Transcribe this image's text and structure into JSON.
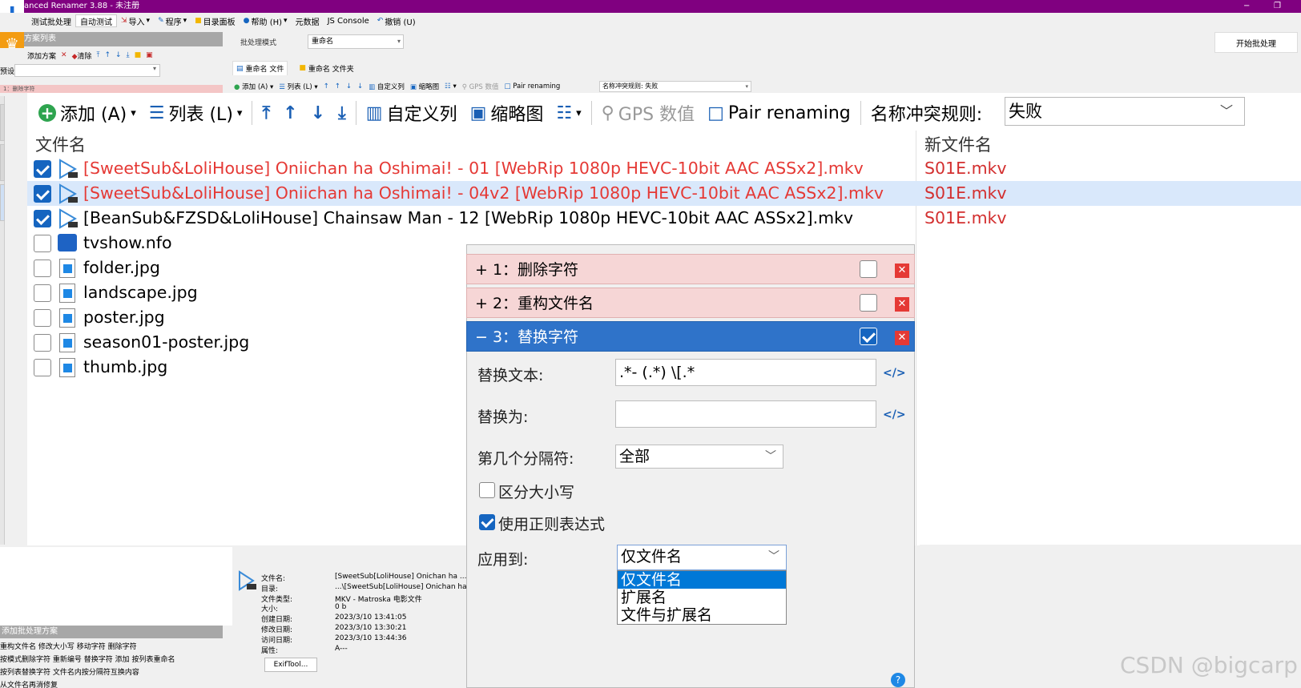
{
  "window": {
    "title": "anced Renamer 3.88 - 未注册",
    "minimize": "−",
    "maximize": "❐"
  },
  "menu": [
    {
      "label": "测试批处理"
    },
    {
      "label": "自动测试"
    },
    {
      "label": "导入",
      "icon": "import-icon"
    },
    {
      "label": "程序",
      "icon": "program-icon"
    },
    {
      "label": "目录面板",
      "icon": "folder-icon"
    },
    {
      "label": "帮助 (H)",
      "icon": "help-icon"
    },
    {
      "label": "元数据"
    },
    {
      "label": "JS Console"
    },
    {
      "label": "撤销 (U)",
      "icon": "undo-icon"
    }
  ],
  "left_panel": {
    "header": "方案列表",
    "toolbar": [
      "添加方案",
      "清除"
    ],
    "combo_label": "预设:",
    "rule_strip": "1：删除字符"
  },
  "top": {
    "mode_label": "批处理模式",
    "mode_value": "重命名",
    "start_button": "开始批处理"
  },
  "tabs": [
    {
      "label": "重命名 文件",
      "active": true
    },
    {
      "label": "重命名 文件夹",
      "active": false
    }
  ],
  "small_toolbar": {
    "items": [
      "添加 (A)",
      "列表 (L)",
      "↑",
      "↑",
      "↓",
      "↓",
      "自定义列",
      "缩略图",
      "GPS 数值",
      "Pair renaming"
    ],
    "conflict": "名称冲突规则: 失败"
  },
  "toolbar": {
    "add": "添加 (A)",
    "list": "列表 (L)",
    "move_top": "⤒",
    "move_up": "↑",
    "move_down": "↓",
    "move_bottom": "⤓",
    "custom_columns": "自定义列",
    "thumbnail": "缩略图",
    "gps": "GPS 数值",
    "pair": "Pair renaming",
    "conflict_label": "名称冲突规则:",
    "conflict_value": "失败"
  },
  "columns": {
    "filename": "文件名",
    "newname": "新文件名"
  },
  "files": [
    {
      "name": "[SweetSub&LoliHouse] Oniichan ha Oshimai! - 01 [WebRip 1080p HEVC-10bit AAC ASSx2].mkv",
      "new": "S01E.mkv",
      "checked": true,
      "red": true,
      "type": "video"
    },
    {
      "name": "[SweetSub&LoliHouse] Oniichan ha Oshimai! - 04v2 [WebRip 1080p HEVC-10bit AAC ASSx2].mkv",
      "new": "S01E.mkv",
      "checked": true,
      "red": true,
      "type": "video"
    },
    {
      "name": "[BeanSub&FZSD&LoliHouse] Chainsaw Man - 12 [WebRip 1080p HEVC-10bit AAC ASSx2].mkv",
      "new": "S01E.mkv",
      "checked": true,
      "red": false,
      "type": "video"
    },
    {
      "name": "tvshow.nfo",
      "new": "",
      "checked": false,
      "red": false,
      "type": "nfo"
    },
    {
      "name": "folder.jpg",
      "new": "",
      "checked": false,
      "red": false,
      "type": "image"
    },
    {
      "name": "landscape.jpg",
      "new": "",
      "checked": false,
      "red": false,
      "type": "image"
    },
    {
      "name": "poster.jpg",
      "new": "",
      "checked": false,
      "red": false,
      "type": "image"
    },
    {
      "name": "season01-poster.jpg",
      "new": "",
      "checked": false,
      "red": false,
      "type": "image"
    },
    {
      "name": "thumb.jpg",
      "new": "",
      "checked": false,
      "red": false,
      "type": "image"
    }
  ],
  "rules": [
    {
      "label": "+ 1：删除字符",
      "checked": false,
      "expanded": false
    },
    {
      "label": "+ 2：重构文件名",
      "checked": false,
      "expanded": false
    },
    {
      "label": "− 3：替换字符",
      "checked": true,
      "expanded": true
    }
  ],
  "rule_form": {
    "replace_text_label": "替换文本:",
    "replace_text_value": ".*- (.*) \\[.*",
    "replace_with_label": "替换为:",
    "replace_with_value": "",
    "nth_sep_label": "第几个分隔符:",
    "nth_sep_value": "全部",
    "case_label": "区分大小写",
    "case_checked": false,
    "regex_label": "使用正则表达式",
    "regex_checked": true,
    "apply_label": "应用到:",
    "apply_value": "仅文件名",
    "apply_options": [
      "仅文件名",
      "扩展名",
      "文件与扩展名"
    ],
    "code_icon": "</>"
  },
  "info": {
    "rows": [
      {
        "k": "文件名:",
        "v": "[SweetSub[LoliHouse] Onichan ha ..."
      },
      {
        "k": "目录:",
        "v": "...\\[SweetSub[LoliHouse] Onichan ha"
      },
      {
        "k": "文件类型:",
        "v": "MKV - Matroska 电影文件"
      },
      {
        "k": "大小:",
        "v": "0 b"
      },
      {
        "k": "创建日期:",
        "v": "2023/3/10 13:41:05"
      },
      {
        "k": "修改日期:",
        "v": "2023/3/10 13:30:21"
      },
      {
        "k": "访问日期:",
        "v": "2023/3/10 13:44:36"
      },
      {
        "k": "属性:",
        "v": "A---"
      }
    ],
    "exif_button": "ExifTool..."
  },
  "bottom_left": {
    "header": "添加批处理方案",
    "lines": [
      "重构文件名  修改大小写  移动字符  删除字符",
      "按模式删除字符  重新编号  替换字符  添加  按列表重命名",
      "按列表替换字符  文件名内按分隔符互换内容",
      "从文件名再消修复"
    ]
  },
  "watermark": "CSDN @bigcarp",
  "help": "?",
  "colors": {
    "titlebar": "#800080",
    "selected_row": "#d9e8fb",
    "error_red": "#e53935",
    "rule_blue": "#2f73c9",
    "rule_red_bg": "#f6d6d6"
  }
}
